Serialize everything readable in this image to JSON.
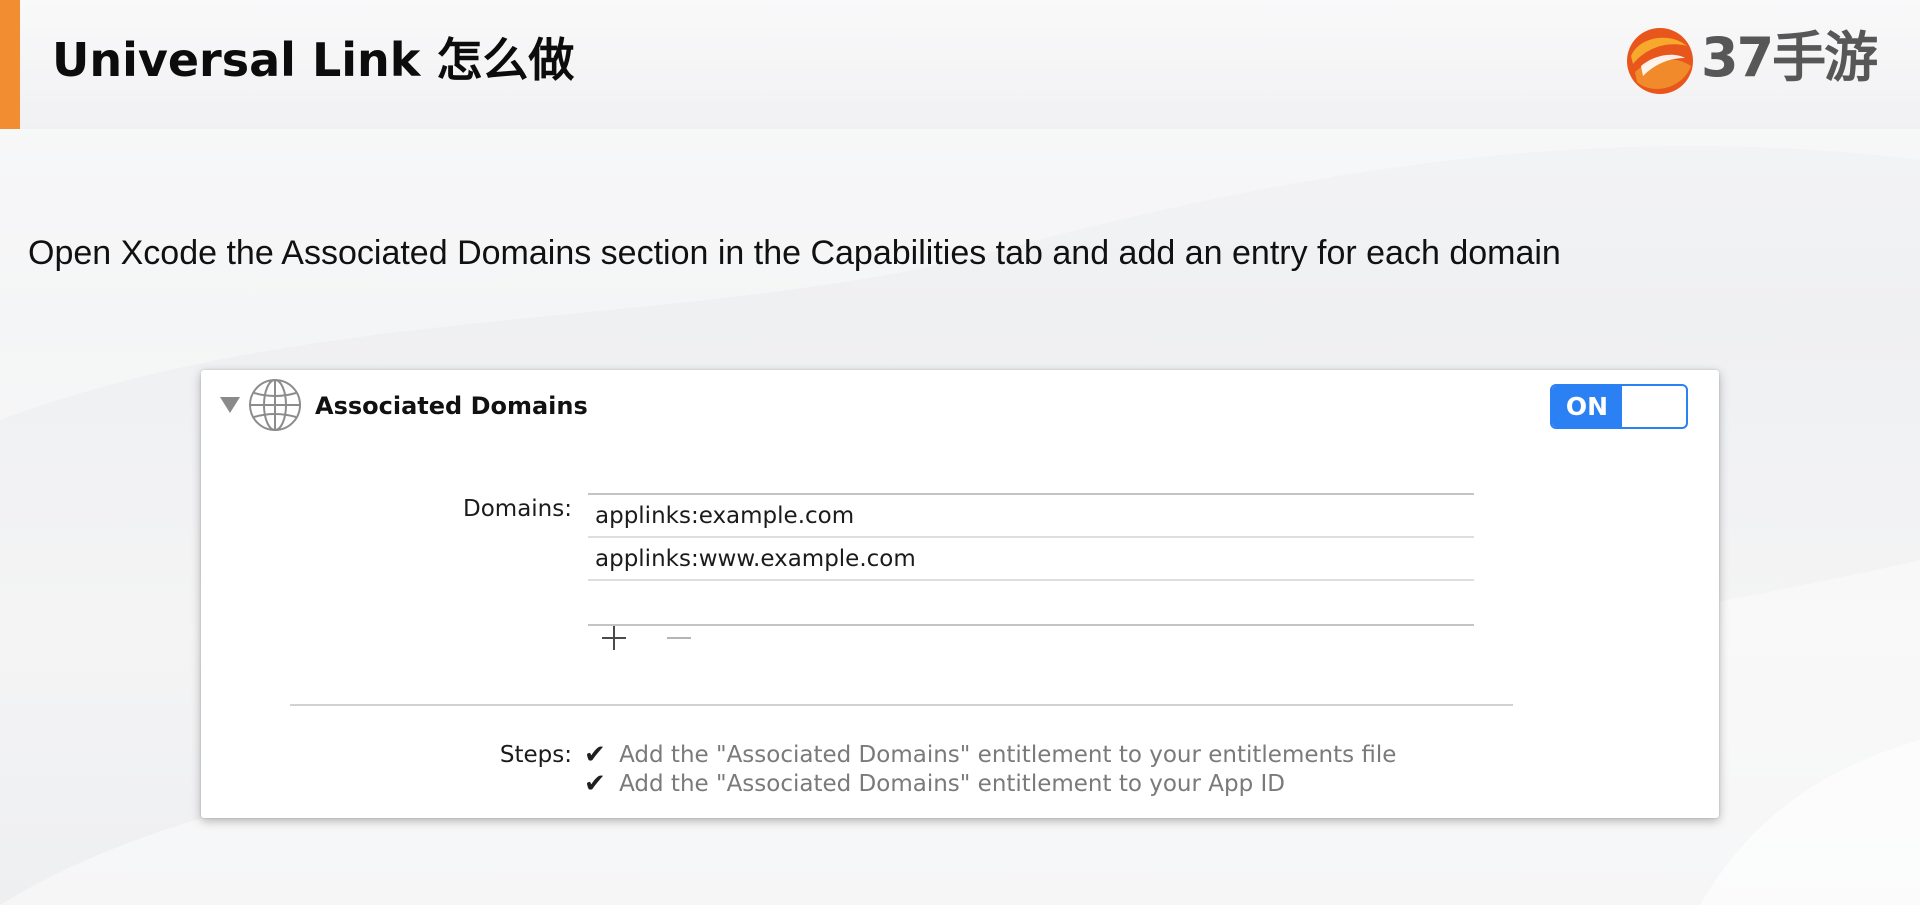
{
  "slide": {
    "title": "Universal Link 怎么做",
    "brand": "37手游",
    "instruction": "Open Xcode the Associated Domains section in the Capabilities tab and add an entry for each domain",
    "accent_color": "#f28d31"
  },
  "capability": {
    "name": "Associated Domains",
    "icon": "globe-icon",
    "toggle_label": "ON",
    "toggle_state": "on",
    "toggle_color": "#2b80f4",
    "domains_label": "Domains:",
    "domains": [
      "applinks:example.com",
      "applinks:www.example.com",
      ""
    ],
    "add_icon": "plus-icon",
    "remove_icon": "minus-icon",
    "steps_label": "Steps:",
    "steps": [
      {
        "icon": "checkmark-icon",
        "text": "Add the \"Associated Domains\" entitlement to your entitlements file"
      },
      {
        "icon": "checkmark-icon",
        "text": "Add the \"Associated Domains\" entitlement to your App ID"
      }
    ]
  }
}
